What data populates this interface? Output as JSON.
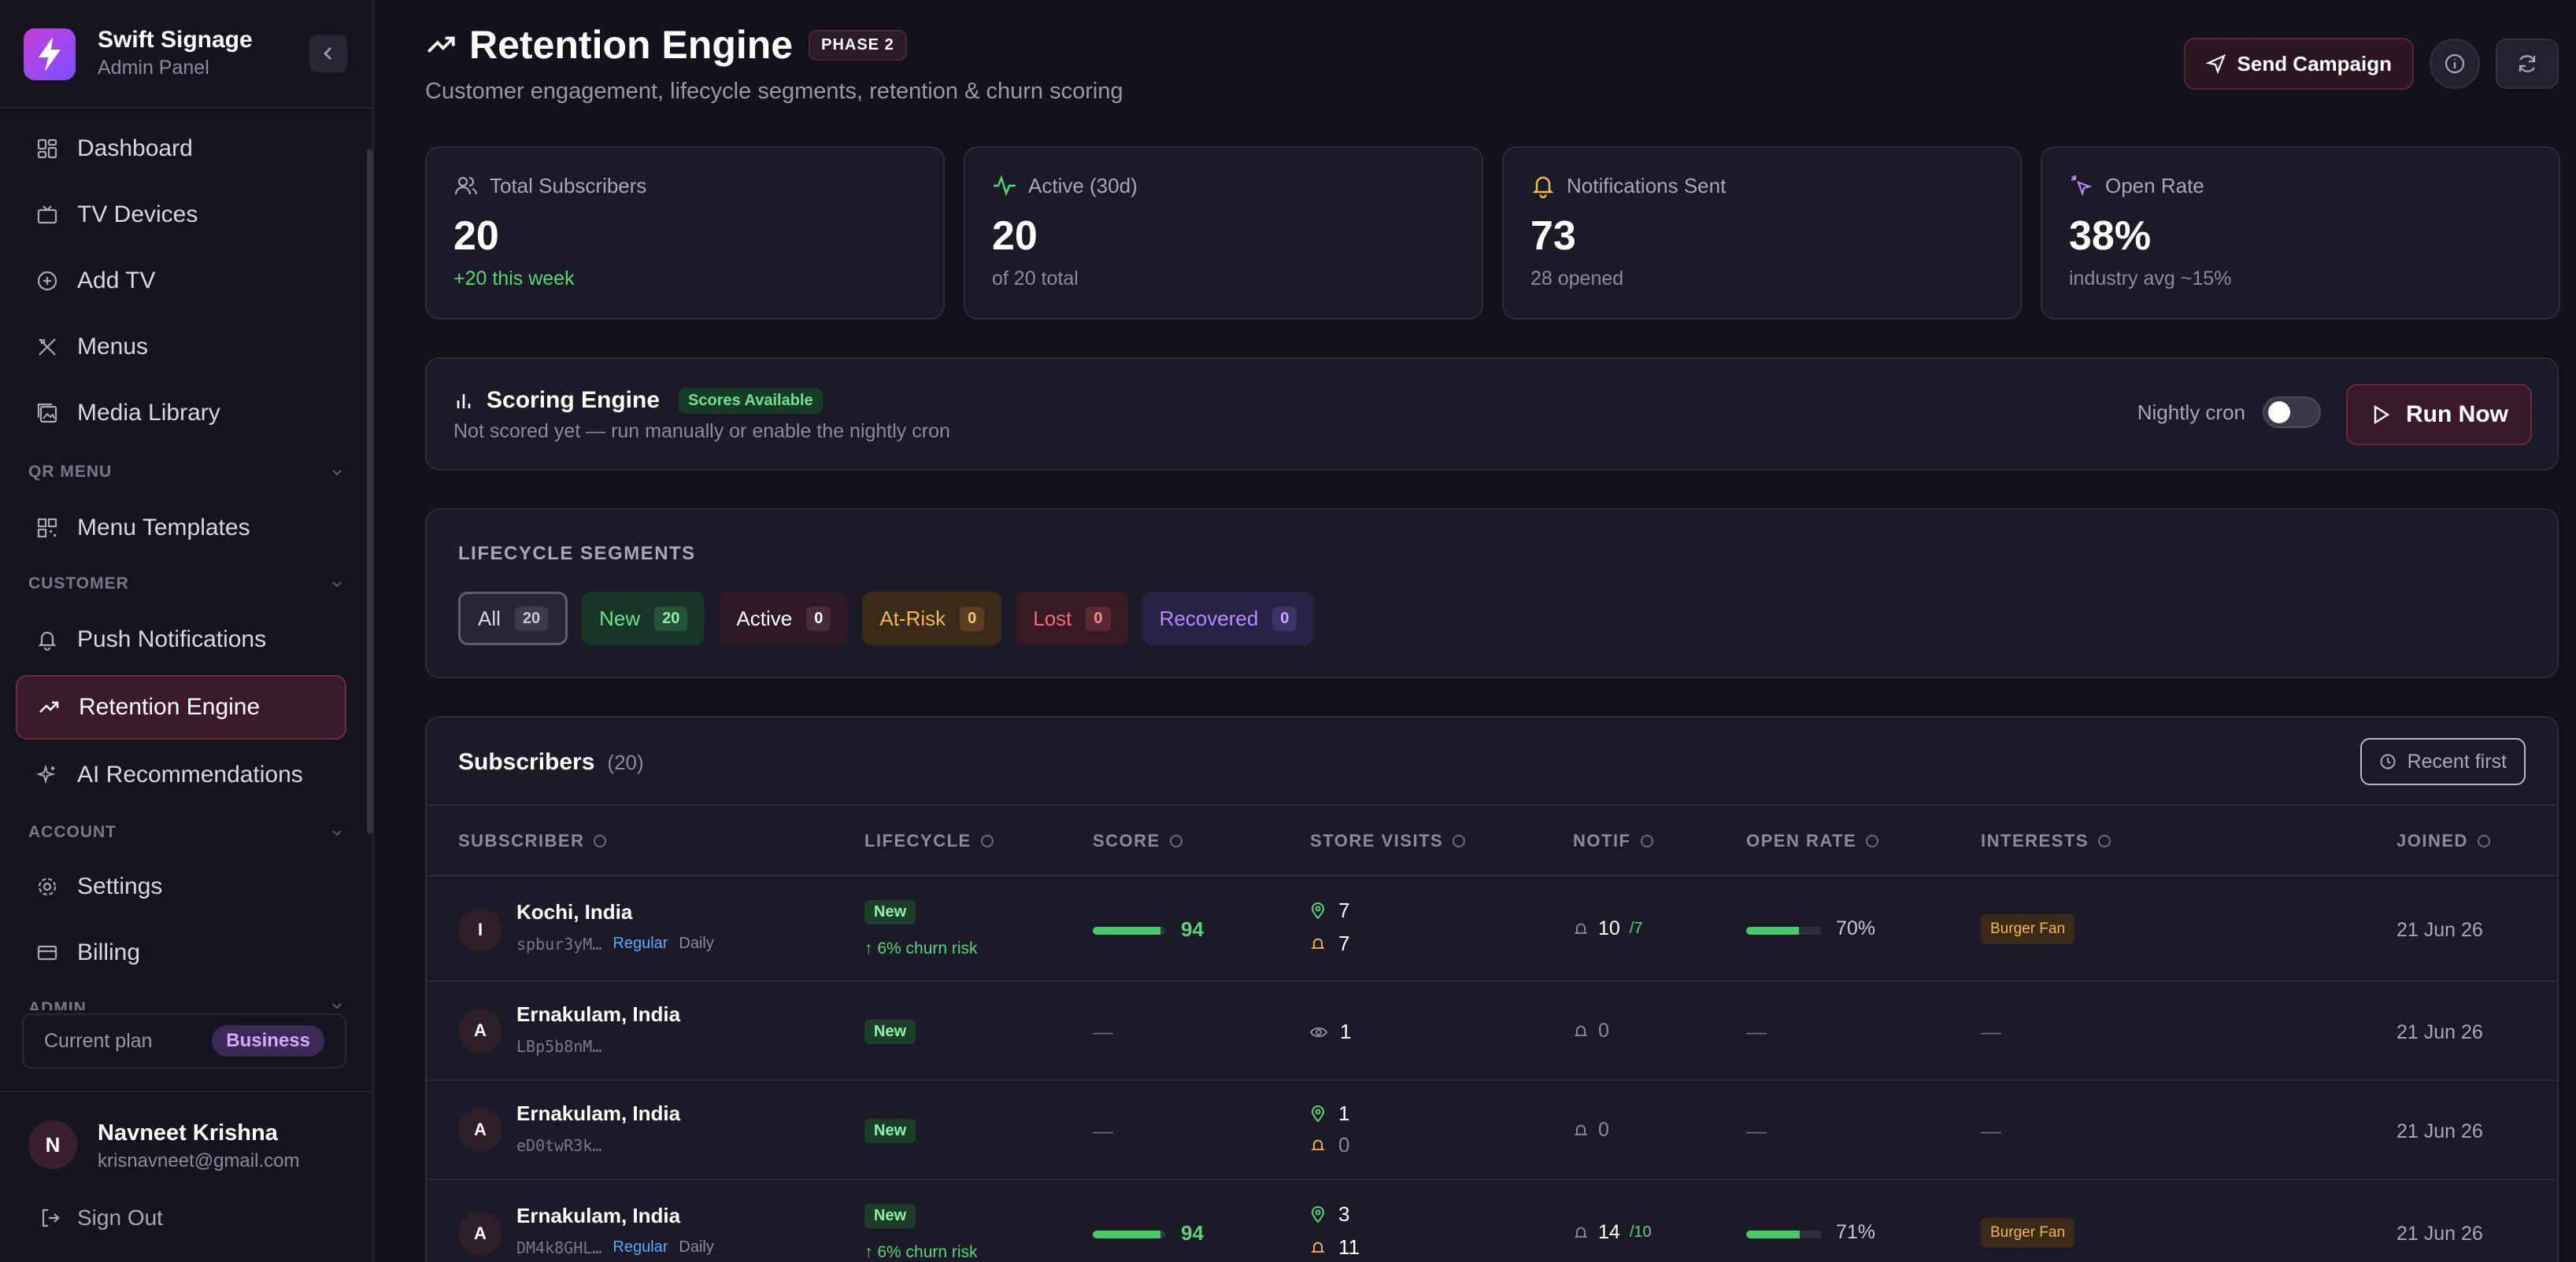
{
  "brand": {
    "name": "Swift Signage",
    "subtitle": "Admin Panel"
  },
  "sidebar": {
    "items": [
      {
        "label": "Dashboard"
      },
      {
        "label": "TV Devices"
      },
      {
        "label": "Add TV"
      },
      {
        "label": "Menus"
      },
      {
        "label": "Media Library"
      },
      {
        "label": "Menu Templates"
      },
      {
        "label": "Push Notifications"
      },
      {
        "label": "Retention Engine"
      },
      {
        "label": "AI Recommendations"
      },
      {
        "label": "Settings"
      },
      {
        "label": "Billing"
      }
    ],
    "sections": [
      "QR MENU",
      "CUSTOMER",
      "ACCOUNT",
      "ADMIN"
    ],
    "plan_label": "Current plan",
    "plan_value": "Business"
  },
  "user": {
    "initial": "N",
    "name": "Navneet Krishna",
    "email": "krisnavneet@gmail.com",
    "signout": "Sign Out"
  },
  "header": {
    "title": "Retention Engine",
    "phase": "PHASE 2",
    "subtitle": "Customer engagement, lifecycle segments, retention & churn scoring",
    "send_campaign": "Send Campaign"
  },
  "stats": [
    {
      "label": "Total Subscribers",
      "value": "20",
      "foot": "+20 this week",
      "icon": "users-icon"
    },
    {
      "label": "Active (30d)",
      "value": "20",
      "foot": "of 20 total",
      "icon": "activity-icon"
    },
    {
      "label": "Notifications Sent",
      "value": "73",
      "foot": "28 opened",
      "icon": "bell-icon"
    },
    {
      "label": "Open Rate",
      "value": "38%",
      "foot": "industry avg ~15%",
      "icon": "pointer-icon"
    }
  ],
  "scoring": {
    "title": "Scoring Engine",
    "badge": "Scores Available",
    "desc": "Not scored yet — run manually or enable the nightly cron",
    "cron_label": "Nightly cron",
    "cron_on": false,
    "run_label": "Run Now"
  },
  "segments": {
    "title": "LIFECYCLE SEGMENTS",
    "items": [
      {
        "label": "All",
        "count": "20"
      },
      {
        "label": "New",
        "count": "20"
      },
      {
        "label": "Active",
        "count": "0"
      },
      {
        "label": "At-Risk",
        "count": "0"
      },
      {
        "label": "Lost",
        "count": "0"
      },
      {
        "label": "Recovered",
        "count": "0"
      }
    ]
  },
  "subscribers": {
    "title": "Subscribers",
    "count": "(20)",
    "sort": "Recent first",
    "columns": [
      "SUBSCRIBER",
      "LIFECYCLE",
      "SCORE",
      "STORE VISITS",
      "NOTIF",
      "OPEN RATE",
      "INTERESTS",
      "JOINED"
    ],
    "rows": [
      {
        "initial": "I",
        "location": "Kochi, India",
        "id": "spbur3yM…",
        "tag": "Regular",
        "freq": "Daily",
        "lifecycle": "New",
        "churn": "↑ 6% churn risk",
        "score": 94,
        "score_text": "94",
        "visits_qr": "7",
        "visits_notif": "7",
        "notif": "10",
        "notif_sub": "/7",
        "open_rate": 0.7,
        "open_rate_text": "70%",
        "interest": "Burger Fan",
        "joined": "21 Jun 26"
      },
      {
        "initial": "A",
        "location": "Ernakulam, India",
        "id": "LBp5b8nM…",
        "lifecycle": "New",
        "score_text": "—",
        "visits_view": "1",
        "notif": "0",
        "open_rate_text": "—",
        "interest_text": "—",
        "joined": "21 Jun 26"
      },
      {
        "initial": "A",
        "location": "Ernakulam, India",
        "id": "eD0twR3k…",
        "lifecycle": "New",
        "score_text": "—",
        "visits_qr": "1",
        "visits_notif": "0",
        "notif": "0",
        "open_rate_text": "—",
        "interest_text": "—",
        "joined": "21 Jun 26"
      },
      {
        "initial": "A",
        "location": "Ernakulam, India",
        "id": "DM4k8GHL…",
        "tag": "Regular",
        "freq": "Daily",
        "lifecycle": "New",
        "churn": "↑ 6% churn risk",
        "score": 94,
        "score_text": "94",
        "visits_qr": "3",
        "visits_notif": "11",
        "notif": "14",
        "notif_sub": "/10",
        "open_rate": 0.71,
        "open_rate_text": "71%",
        "interest": "Burger Fan",
        "joined": "21 Jun 26"
      }
    ]
  },
  "colors": {
    "accent": "#6a2a44",
    "success": "#5ad37a",
    "background": "#12111c"
  }
}
